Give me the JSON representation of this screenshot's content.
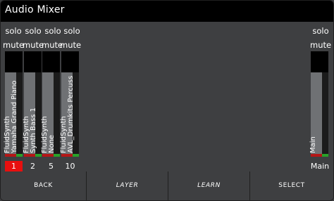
{
  "title": "Audio Mixer",
  "channels": [
    {
      "solo": "solo",
      "mute": "mute",
      "name_line1": "FluidSynth",
      "name_line2": "Yamaha Grand Piano",
      "number": "1",
      "selected": true
    },
    {
      "solo": "solo",
      "mute": "mute",
      "name_line1": "FluidSynth",
      "name_line2": "Synth Bass 1",
      "number": "2",
      "selected": false
    },
    {
      "solo": "solo",
      "mute": "mute",
      "name_line1": "FluidSynth",
      "name_line2": "None",
      "number": "5",
      "selected": false
    },
    {
      "solo": "solo",
      "mute": "mute",
      "name_line1": "FluidSynth",
      "name_line2": "AVL_Drumkits Percuss",
      "number": "10",
      "selected": false
    }
  ],
  "main": {
    "solo": "solo",
    "mute": "mute",
    "name": "Main",
    "number": "Main"
  },
  "buttons": [
    "BACK",
    "LAYER",
    "LEARN",
    "SELECT"
  ],
  "colors": {
    "background": "#3e3f41",
    "selected": "#e80f0f",
    "meter_green": "#29a229",
    "meter_red": "#b51616"
  }
}
